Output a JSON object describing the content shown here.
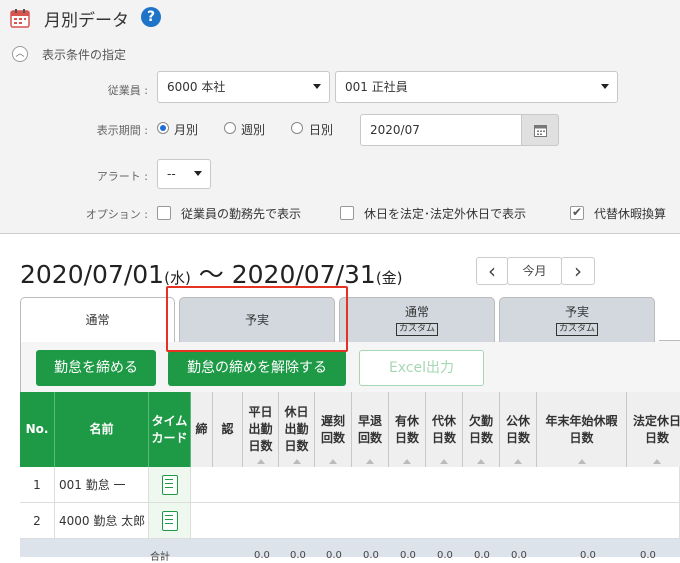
{
  "header": {
    "title": "月別データ",
    "help": "?"
  },
  "conditions": {
    "section_title": "表示条件の指定",
    "employee_label": "従業員 :",
    "employee_value": "6000 本社",
    "employee_type_value": "001 正社員",
    "period_label": "表示期間 :",
    "period_options": [
      "月別",
      "週別",
      "日別"
    ],
    "period_selected": "月別",
    "period_value": "2020/07",
    "alert_label": "アラート :",
    "alert_value": "--",
    "option_label": "オプション :",
    "options": [
      {
        "label": "従業員の勤務先で表示",
        "checked": false
      },
      {
        "label": "休日を法定･法定外休日で表示",
        "checked": false
      },
      {
        "label": "代替休暇換算",
        "checked": true
      }
    ]
  },
  "range": {
    "start": "2020/07/01",
    "start_dow": "(水)",
    "sep": "〜",
    "end": "2020/07/31",
    "end_dow": "(金)"
  },
  "nav": {
    "prev": "‹",
    "this_month": "今月",
    "next": "›"
  },
  "tabs": [
    {
      "label": "通常",
      "tag": ""
    },
    {
      "label": "予実",
      "tag": ""
    },
    {
      "label": "通常",
      "tag": "カスタム"
    },
    {
      "label": "予実",
      "tag": "カスタム"
    }
  ],
  "buttons": {
    "close": "勤怠を締める",
    "unclose": "勤怠の締めを解除する",
    "excel": "Excel出力"
  },
  "table": {
    "headers": {
      "no": "No.",
      "name": "名前",
      "timecard": [
        "タイム",
        "カード"
      ],
      "close": "締",
      "approve": "認",
      "weekday": [
        "平日",
        "出勤",
        "日数"
      ],
      "holiday_work": [
        "休日",
        "出勤",
        "日数"
      ],
      "late": [
        "遅刻",
        "回数"
      ],
      "early": [
        "早退",
        "回数"
      ],
      "paid": [
        "有休",
        "日数"
      ],
      "sub": [
        "代休",
        "日数"
      ],
      "absent": [
        "欠勤",
        "日数"
      ],
      "public": [
        "公休",
        "日数"
      ],
      "newyear": [
        "年末年始休暇",
        "日数"
      ],
      "legal": [
        "法定休日",
        "日数"
      ]
    },
    "rows": [
      {
        "no": "1",
        "name": "001 勤怠 一"
      },
      {
        "no": "2",
        "name": "4000 勤怠 太郎"
      }
    ],
    "sum_label": "合計",
    "sum_value": "0.0"
  },
  "colors": {
    "accent": "#1e9a47",
    "highlight": "#e53323",
    "help": "#1f74c7"
  }
}
